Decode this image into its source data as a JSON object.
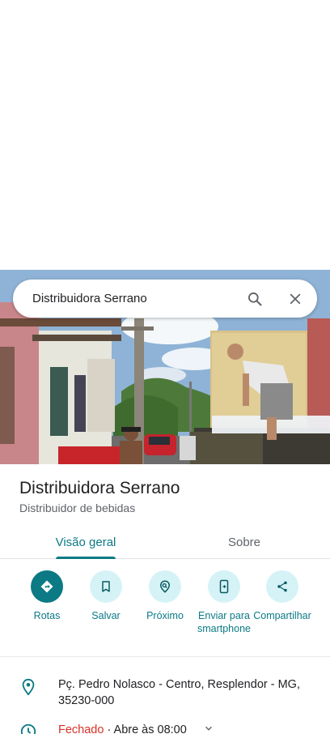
{
  "search": {
    "query": "Distribuidora Serrano"
  },
  "place": {
    "name": "Distribuidora Serrano",
    "category": "Distribuidor de bebidas"
  },
  "tabs": {
    "overview": "Visão geral",
    "about": "Sobre"
  },
  "actions": {
    "directions": "Rotas",
    "save": "Salvar",
    "nearby": "Próximo",
    "send": "Enviar para smartphone",
    "share": "Compartilhar"
  },
  "info": {
    "address": "Pç. Pedro Nolasco - Centro, Resplendor - MG, 35230-000",
    "hours_status": "Fechado",
    "hours_detail": " · Abre às 08:00"
  },
  "colors": {
    "accent": "#0b7a85",
    "accent_light": "#d5f3f6",
    "closed": "#d93025"
  },
  "icons": [
    "search-icon",
    "close-icon",
    "directions-icon",
    "bookmark-icon",
    "nearby-icon",
    "send-to-phone-icon",
    "share-icon",
    "location-pin-icon",
    "clock-icon",
    "chevron-down-icon"
  ]
}
